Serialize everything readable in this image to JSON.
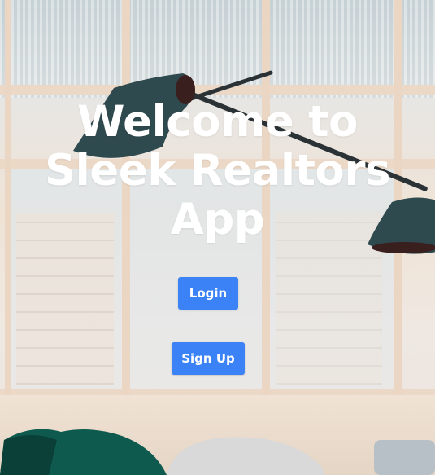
{
  "hero": {
    "title_line1": "Welcome to",
    "title_line2": "Sleek Realtors",
    "title_line3": "App"
  },
  "actions": {
    "login_label": "Login",
    "signup_label": "Sign Up"
  },
  "colors": {
    "button": "#3b82f6",
    "title": "#ffffff"
  },
  "icons": {
    "background": "office-interior-photo"
  }
}
